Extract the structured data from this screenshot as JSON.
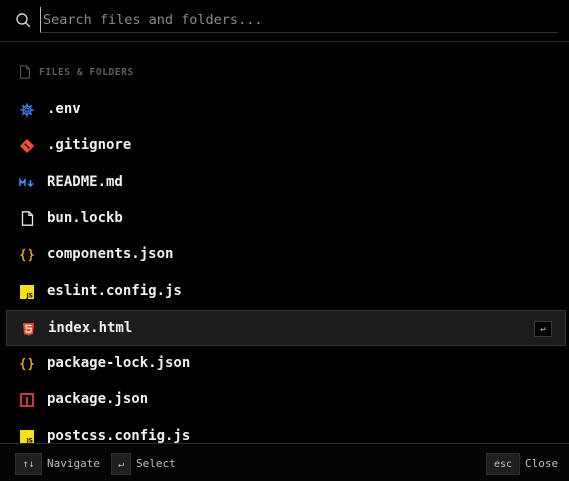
{
  "search": {
    "placeholder": "Search files and folders..."
  },
  "section": {
    "label": "FILES & FOLDERS"
  },
  "items": [
    {
      "name": ".env",
      "icon": "gear-icon",
      "color": "#3b82f6"
    },
    {
      "name": ".gitignore",
      "icon": "git-icon",
      "color": "#f05133"
    },
    {
      "name": "README.md",
      "icon": "markdown-icon",
      "color": "#4f8ff7"
    },
    {
      "name": "bun.lockb",
      "icon": "file-icon",
      "color": "#e8e8e8"
    },
    {
      "name": "components.json",
      "icon": "json-braces-icon",
      "color": "#f5a524"
    },
    {
      "name": "eslint.config.js",
      "icon": "javascript-icon",
      "color": "#f7df1e"
    },
    {
      "name": "index.html",
      "icon": "html5-icon",
      "color": "#e34c26"
    },
    {
      "name": "package-lock.json",
      "icon": "json-braces-icon",
      "color": "#f5a524"
    },
    {
      "name": "package.json",
      "icon": "npm-icon",
      "color": "#cb3837"
    },
    {
      "name": "postcss.config.js",
      "icon": "javascript-icon",
      "color": "#f7df1e"
    }
  ],
  "selected_index": 6,
  "enter_hint": "↵",
  "footer": {
    "navigate_key": "↑↓",
    "navigate_label": "Navigate",
    "select_key": "↵",
    "select_label": "Select",
    "close_key": "esc",
    "close_label": "Close"
  }
}
